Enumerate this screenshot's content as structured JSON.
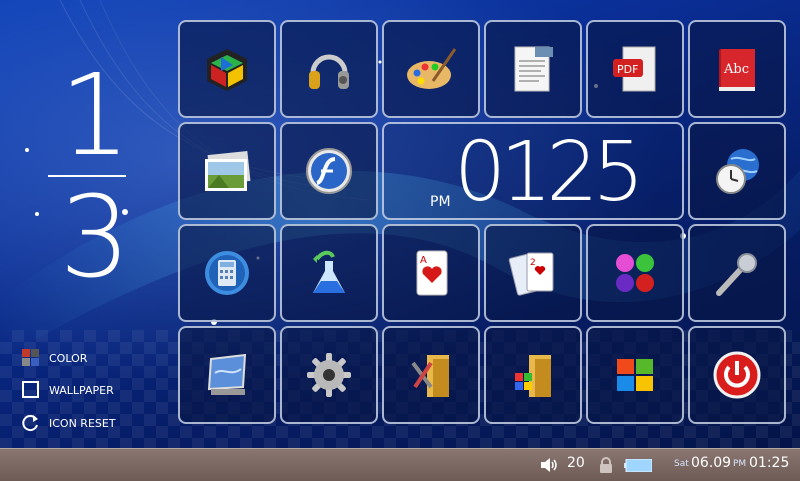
{
  "page_indicator": {
    "current": "1",
    "total": "3"
  },
  "options": {
    "color": "COLOR",
    "wallpaper": "WALLPAPER",
    "icon_reset": "ICON RESET"
  },
  "clock": {
    "ampm": "PM",
    "time": "0125"
  },
  "taskbar": {
    "volume": "20",
    "day": "Sat",
    "date": "06.09",
    "ampm": "PM",
    "time": "01:25"
  },
  "tiles": [
    "media-cube-icon",
    "headphones-icon",
    "paint-palette-icon",
    "text-document-icon",
    "pdf-document-icon",
    "dictionary-icon",
    "photo-stack-icon",
    "flash-icon",
    "world-clock-icon",
    "calculator-icon",
    "lab-flask-icon",
    "playing-card-icon",
    "card-game-icon",
    "color-balls-icon",
    "microphone-icon",
    "wallpaper-icon",
    "settings-gear-icon",
    "tools-folder-icon",
    "windows-folder-icon",
    "windows-logo-icon",
    "power-icon"
  ],
  "colors": {
    "accent": "#0d3fb6",
    "taskbar": "#7b6762",
    "power": "#d91d1d"
  }
}
